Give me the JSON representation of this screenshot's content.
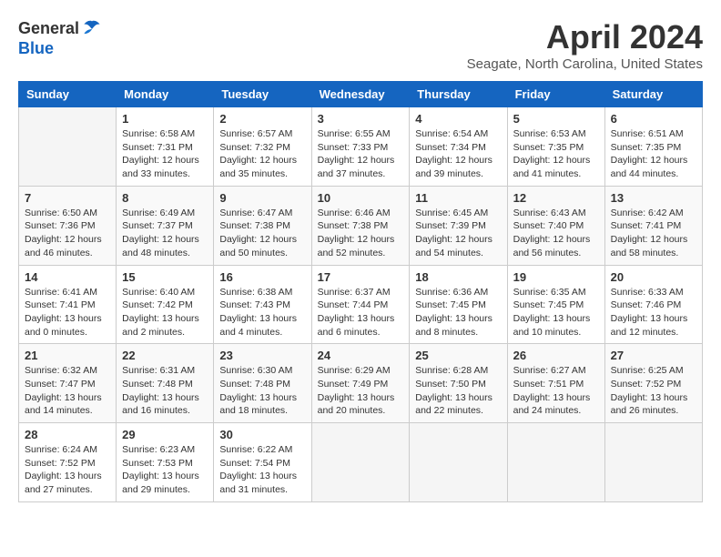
{
  "header": {
    "logo_general": "General",
    "logo_blue": "Blue",
    "month_title": "April 2024",
    "location": "Seagate, North Carolina, United States"
  },
  "days_of_week": [
    "Sunday",
    "Monday",
    "Tuesday",
    "Wednesday",
    "Thursday",
    "Friday",
    "Saturday"
  ],
  "weeks": [
    [
      {
        "day": "",
        "info": ""
      },
      {
        "day": "1",
        "info": "Sunrise: 6:58 AM\nSunset: 7:31 PM\nDaylight: 12 hours\nand 33 minutes."
      },
      {
        "day": "2",
        "info": "Sunrise: 6:57 AM\nSunset: 7:32 PM\nDaylight: 12 hours\nand 35 minutes."
      },
      {
        "day": "3",
        "info": "Sunrise: 6:55 AM\nSunset: 7:33 PM\nDaylight: 12 hours\nand 37 minutes."
      },
      {
        "day": "4",
        "info": "Sunrise: 6:54 AM\nSunset: 7:34 PM\nDaylight: 12 hours\nand 39 minutes."
      },
      {
        "day": "5",
        "info": "Sunrise: 6:53 AM\nSunset: 7:35 PM\nDaylight: 12 hours\nand 41 minutes."
      },
      {
        "day": "6",
        "info": "Sunrise: 6:51 AM\nSunset: 7:35 PM\nDaylight: 12 hours\nand 44 minutes."
      }
    ],
    [
      {
        "day": "7",
        "info": "Sunrise: 6:50 AM\nSunset: 7:36 PM\nDaylight: 12 hours\nand 46 minutes."
      },
      {
        "day": "8",
        "info": "Sunrise: 6:49 AM\nSunset: 7:37 PM\nDaylight: 12 hours\nand 48 minutes."
      },
      {
        "day": "9",
        "info": "Sunrise: 6:47 AM\nSunset: 7:38 PM\nDaylight: 12 hours\nand 50 minutes."
      },
      {
        "day": "10",
        "info": "Sunrise: 6:46 AM\nSunset: 7:38 PM\nDaylight: 12 hours\nand 52 minutes."
      },
      {
        "day": "11",
        "info": "Sunrise: 6:45 AM\nSunset: 7:39 PM\nDaylight: 12 hours\nand 54 minutes."
      },
      {
        "day": "12",
        "info": "Sunrise: 6:43 AM\nSunset: 7:40 PM\nDaylight: 12 hours\nand 56 minutes."
      },
      {
        "day": "13",
        "info": "Sunrise: 6:42 AM\nSunset: 7:41 PM\nDaylight: 12 hours\nand 58 minutes."
      }
    ],
    [
      {
        "day": "14",
        "info": "Sunrise: 6:41 AM\nSunset: 7:41 PM\nDaylight: 13 hours\nand 0 minutes."
      },
      {
        "day": "15",
        "info": "Sunrise: 6:40 AM\nSunset: 7:42 PM\nDaylight: 13 hours\nand 2 minutes."
      },
      {
        "day": "16",
        "info": "Sunrise: 6:38 AM\nSunset: 7:43 PM\nDaylight: 13 hours\nand 4 minutes."
      },
      {
        "day": "17",
        "info": "Sunrise: 6:37 AM\nSunset: 7:44 PM\nDaylight: 13 hours\nand 6 minutes."
      },
      {
        "day": "18",
        "info": "Sunrise: 6:36 AM\nSunset: 7:45 PM\nDaylight: 13 hours\nand 8 minutes."
      },
      {
        "day": "19",
        "info": "Sunrise: 6:35 AM\nSunset: 7:45 PM\nDaylight: 13 hours\nand 10 minutes."
      },
      {
        "day": "20",
        "info": "Sunrise: 6:33 AM\nSunset: 7:46 PM\nDaylight: 13 hours\nand 12 minutes."
      }
    ],
    [
      {
        "day": "21",
        "info": "Sunrise: 6:32 AM\nSunset: 7:47 PM\nDaylight: 13 hours\nand 14 minutes."
      },
      {
        "day": "22",
        "info": "Sunrise: 6:31 AM\nSunset: 7:48 PM\nDaylight: 13 hours\nand 16 minutes."
      },
      {
        "day": "23",
        "info": "Sunrise: 6:30 AM\nSunset: 7:48 PM\nDaylight: 13 hours\nand 18 minutes."
      },
      {
        "day": "24",
        "info": "Sunrise: 6:29 AM\nSunset: 7:49 PM\nDaylight: 13 hours\nand 20 minutes."
      },
      {
        "day": "25",
        "info": "Sunrise: 6:28 AM\nSunset: 7:50 PM\nDaylight: 13 hours\nand 22 minutes."
      },
      {
        "day": "26",
        "info": "Sunrise: 6:27 AM\nSunset: 7:51 PM\nDaylight: 13 hours\nand 24 minutes."
      },
      {
        "day": "27",
        "info": "Sunrise: 6:25 AM\nSunset: 7:52 PM\nDaylight: 13 hours\nand 26 minutes."
      }
    ],
    [
      {
        "day": "28",
        "info": "Sunrise: 6:24 AM\nSunset: 7:52 PM\nDaylight: 13 hours\nand 27 minutes."
      },
      {
        "day": "29",
        "info": "Sunrise: 6:23 AM\nSunset: 7:53 PM\nDaylight: 13 hours\nand 29 minutes."
      },
      {
        "day": "30",
        "info": "Sunrise: 6:22 AM\nSunset: 7:54 PM\nDaylight: 13 hours\nand 31 minutes."
      },
      {
        "day": "",
        "info": ""
      },
      {
        "day": "",
        "info": ""
      },
      {
        "day": "",
        "info": ""
      },
      {
        "day": "",
        "info": ""
      }
    ]
  ]
}
